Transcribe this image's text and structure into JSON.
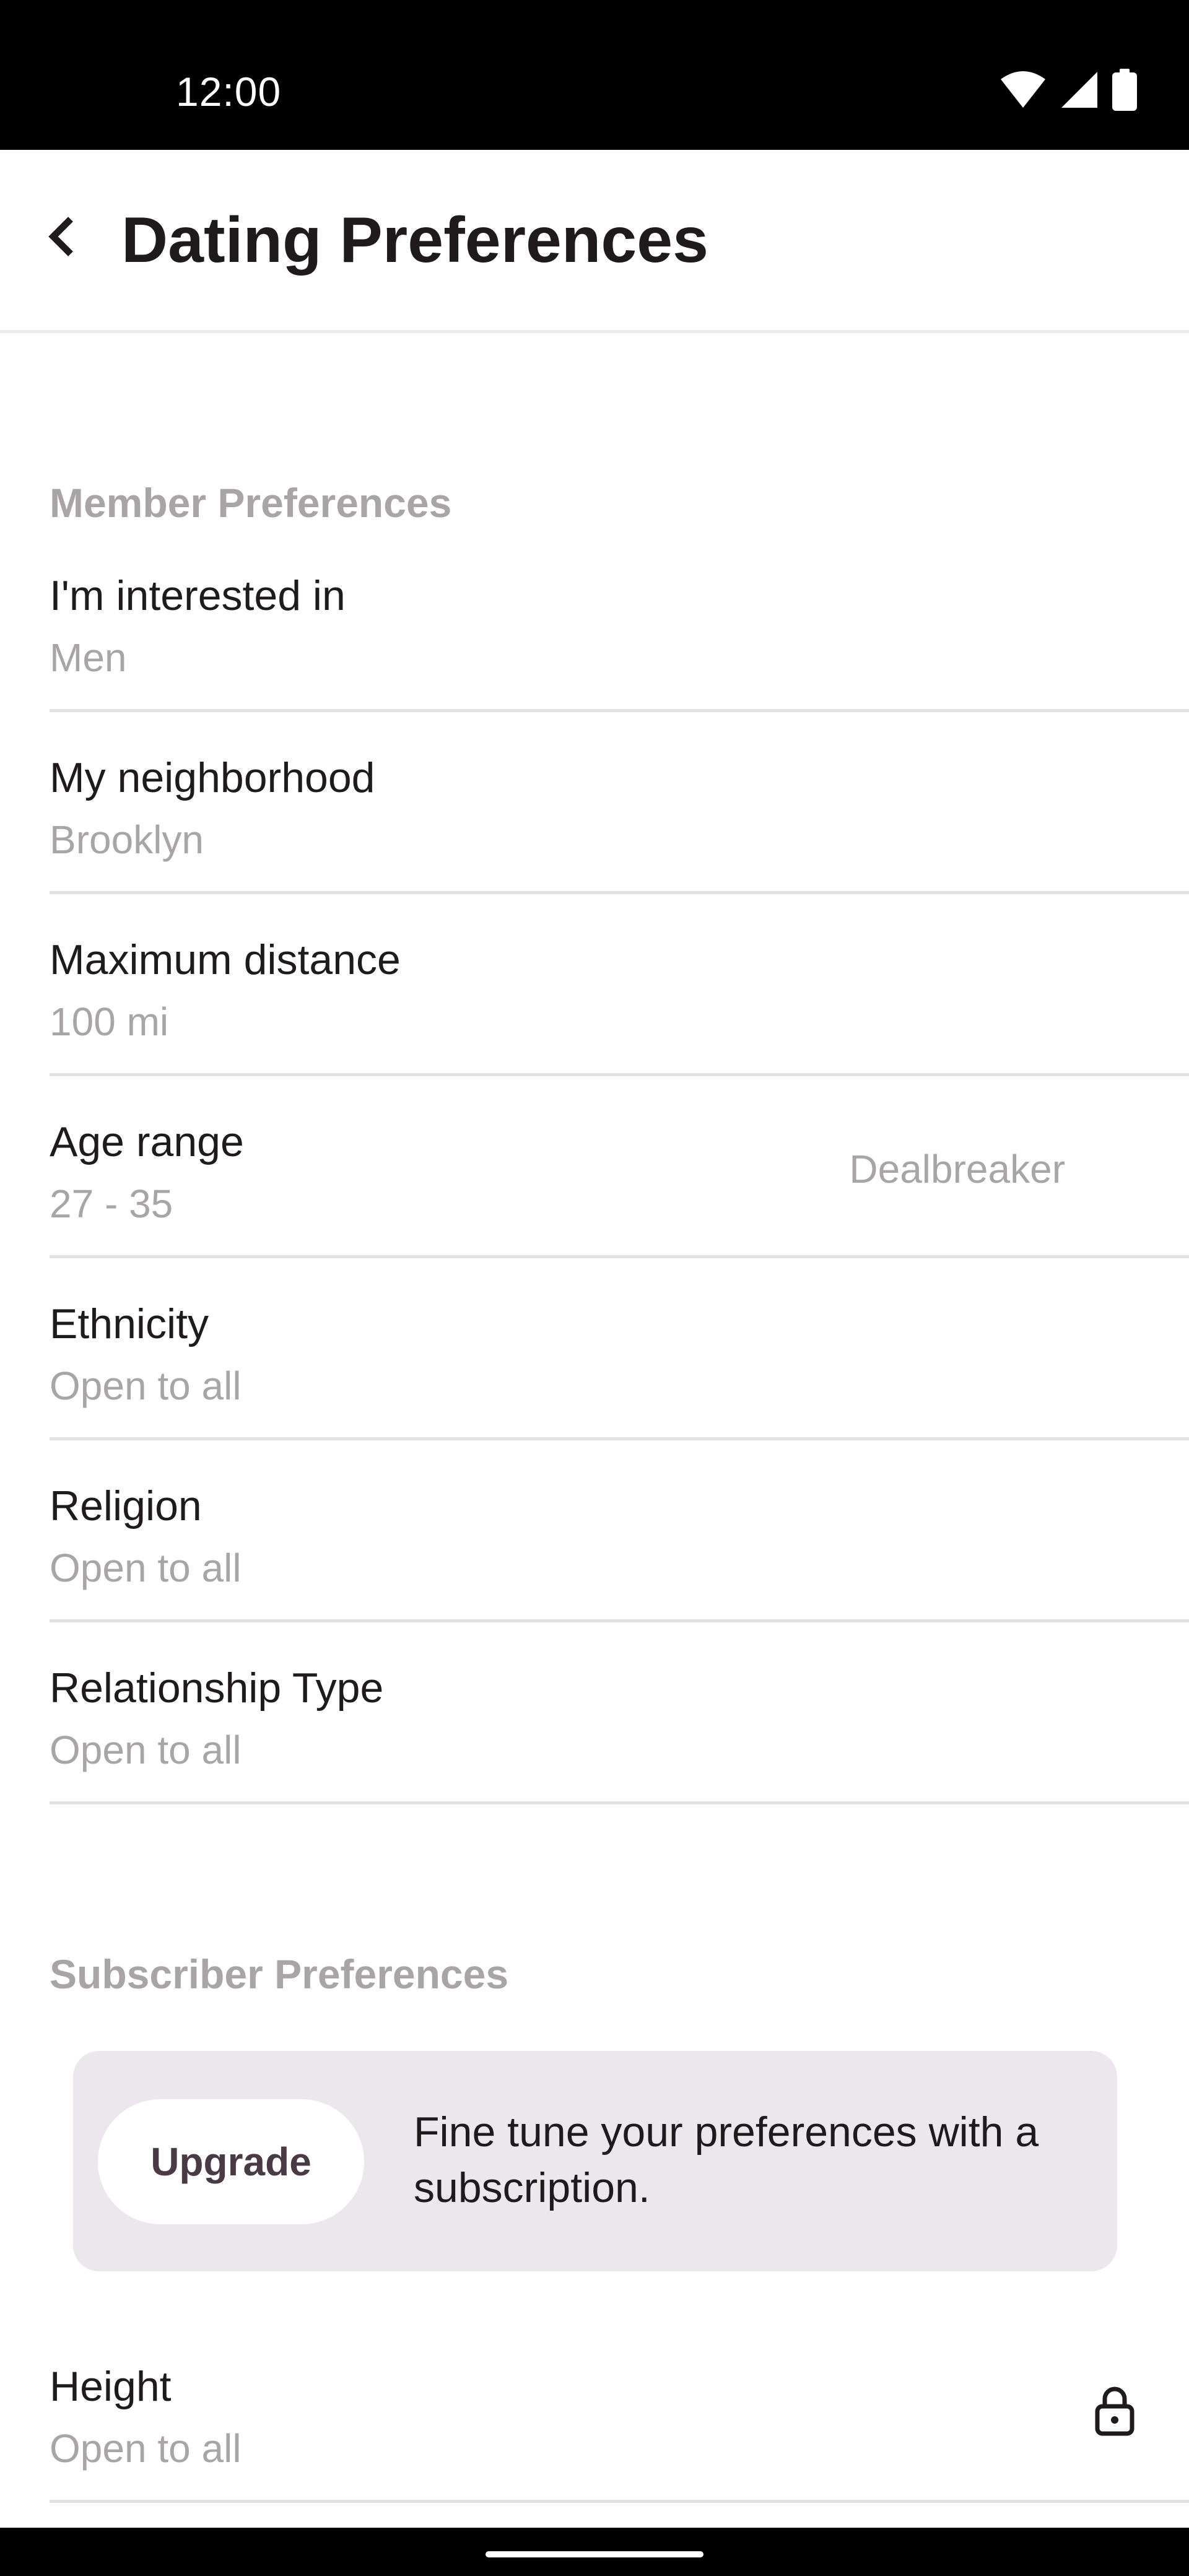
{
  "status_bar": {
    "time": "12:00",
    "icons": [
      "wifi-icon",
      "signal-icon",
      "battery-icon"
    ]
  },
  "header": {
    "back_icon": "chevron-left-icon",
    "title": "Dating Preferences"
  },
  "member_preferences": {
    "heading": "Member Preferences",
    "items": [
      {
        "label": "I'm interested in",
        "value": "Men"
      },
      {
        "label": "My neighborhood",
        "value": "Brooklyn"
      },
      {
        "label": "Maximum distance",
        "value": "100 mi"
      },
      {
        "label": "Age range",
        "value": "27 - 35",
        "tag": "Dealbreaker"
      },
      {
        "label": "Ethnicity",
        "value": "Open to all"
      },
      {
        "label": "Religion",
        "value": "Open to all"
      },
      {
        "label": "Relationship Type",
        "value": "Open to all"
      }
    ]
  },
  "subscriber_preferences": {
    "heading": "Subscriber Preferences",
    "upgrade_card": {
      "button_label": "Upgrade",
      "text": "Fine tune your preferences with a subscription."
    },
    "items": [
      {
        "label": "Height",
        "value": "Open to all",
        "icon": "lock-icon"
      }
    ]
  },
  "colors": {
    "text_primary": "#1f1a1c",
    "text_secondary": "#a9a5a7",
    "card_background": "#ebe7ec",
    "upgrade_label": "#4a3a45"
  }
}
